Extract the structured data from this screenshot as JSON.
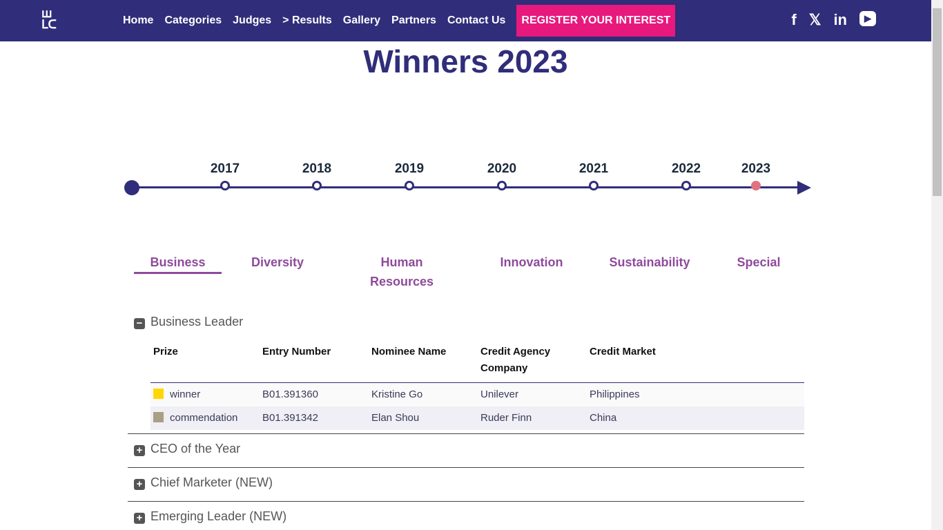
{
  "nav": {
    "logo": "WLC",
    "items": [
      "Home",
      "Categories",
      "Judges",
      "> Results",
      "Gallery",
      "Partners",
      "Contact Us"
    ],
    "register": "REGISTER YOUR INTEREST",
    "social": [
      "f",
      "𝕏",
      "in",
      "▶"
    ]
  },
  "title": "Winners 2023",
  "timeline": {
    "years": [
      "2017",
      "2018",
      "2019",
      "2020",
      "2021",
      "2022",
      "2023"
    ],
    "current": "2023"
  },
  "tabs": [
    "Business",
    "Diversity",
    "Human Resources",
    "Innovation",
    "Sustainability",
    "Special"
  ],
  "active_tab": "Business",
  "sections": [
    {
      "title": "Business Leader",
      "expanded": true
    },
    {
      "title": "CEO of the Year"
    },
    {
      "title": "Chief Marketer (NEW)"
    },
    {
      "title": "Emerging Leader (NEW)"
    }
  ],
  "table": {
    "headers": [
      "Prize",
      "Entry Number",
      "Nominee Name",
      "Credit Agency Company",
      "Credit Market"
    ],
    "rows": [
      {
        "prize": "winner",
        "color": "#ffd700",
        "entry": "B01.391360",
        "name": "Kristine Go",
        "agency": "Unilever",
        "market": "Philippines"
      },
      {
        "prize": "commendation",
        "color": "#a89f86",
        "entry": "B01.391342",
        "name": "Elan Shou",
        "agency": "Ruder Finn",
        "market": "China"
      }
    ]
  }
}
